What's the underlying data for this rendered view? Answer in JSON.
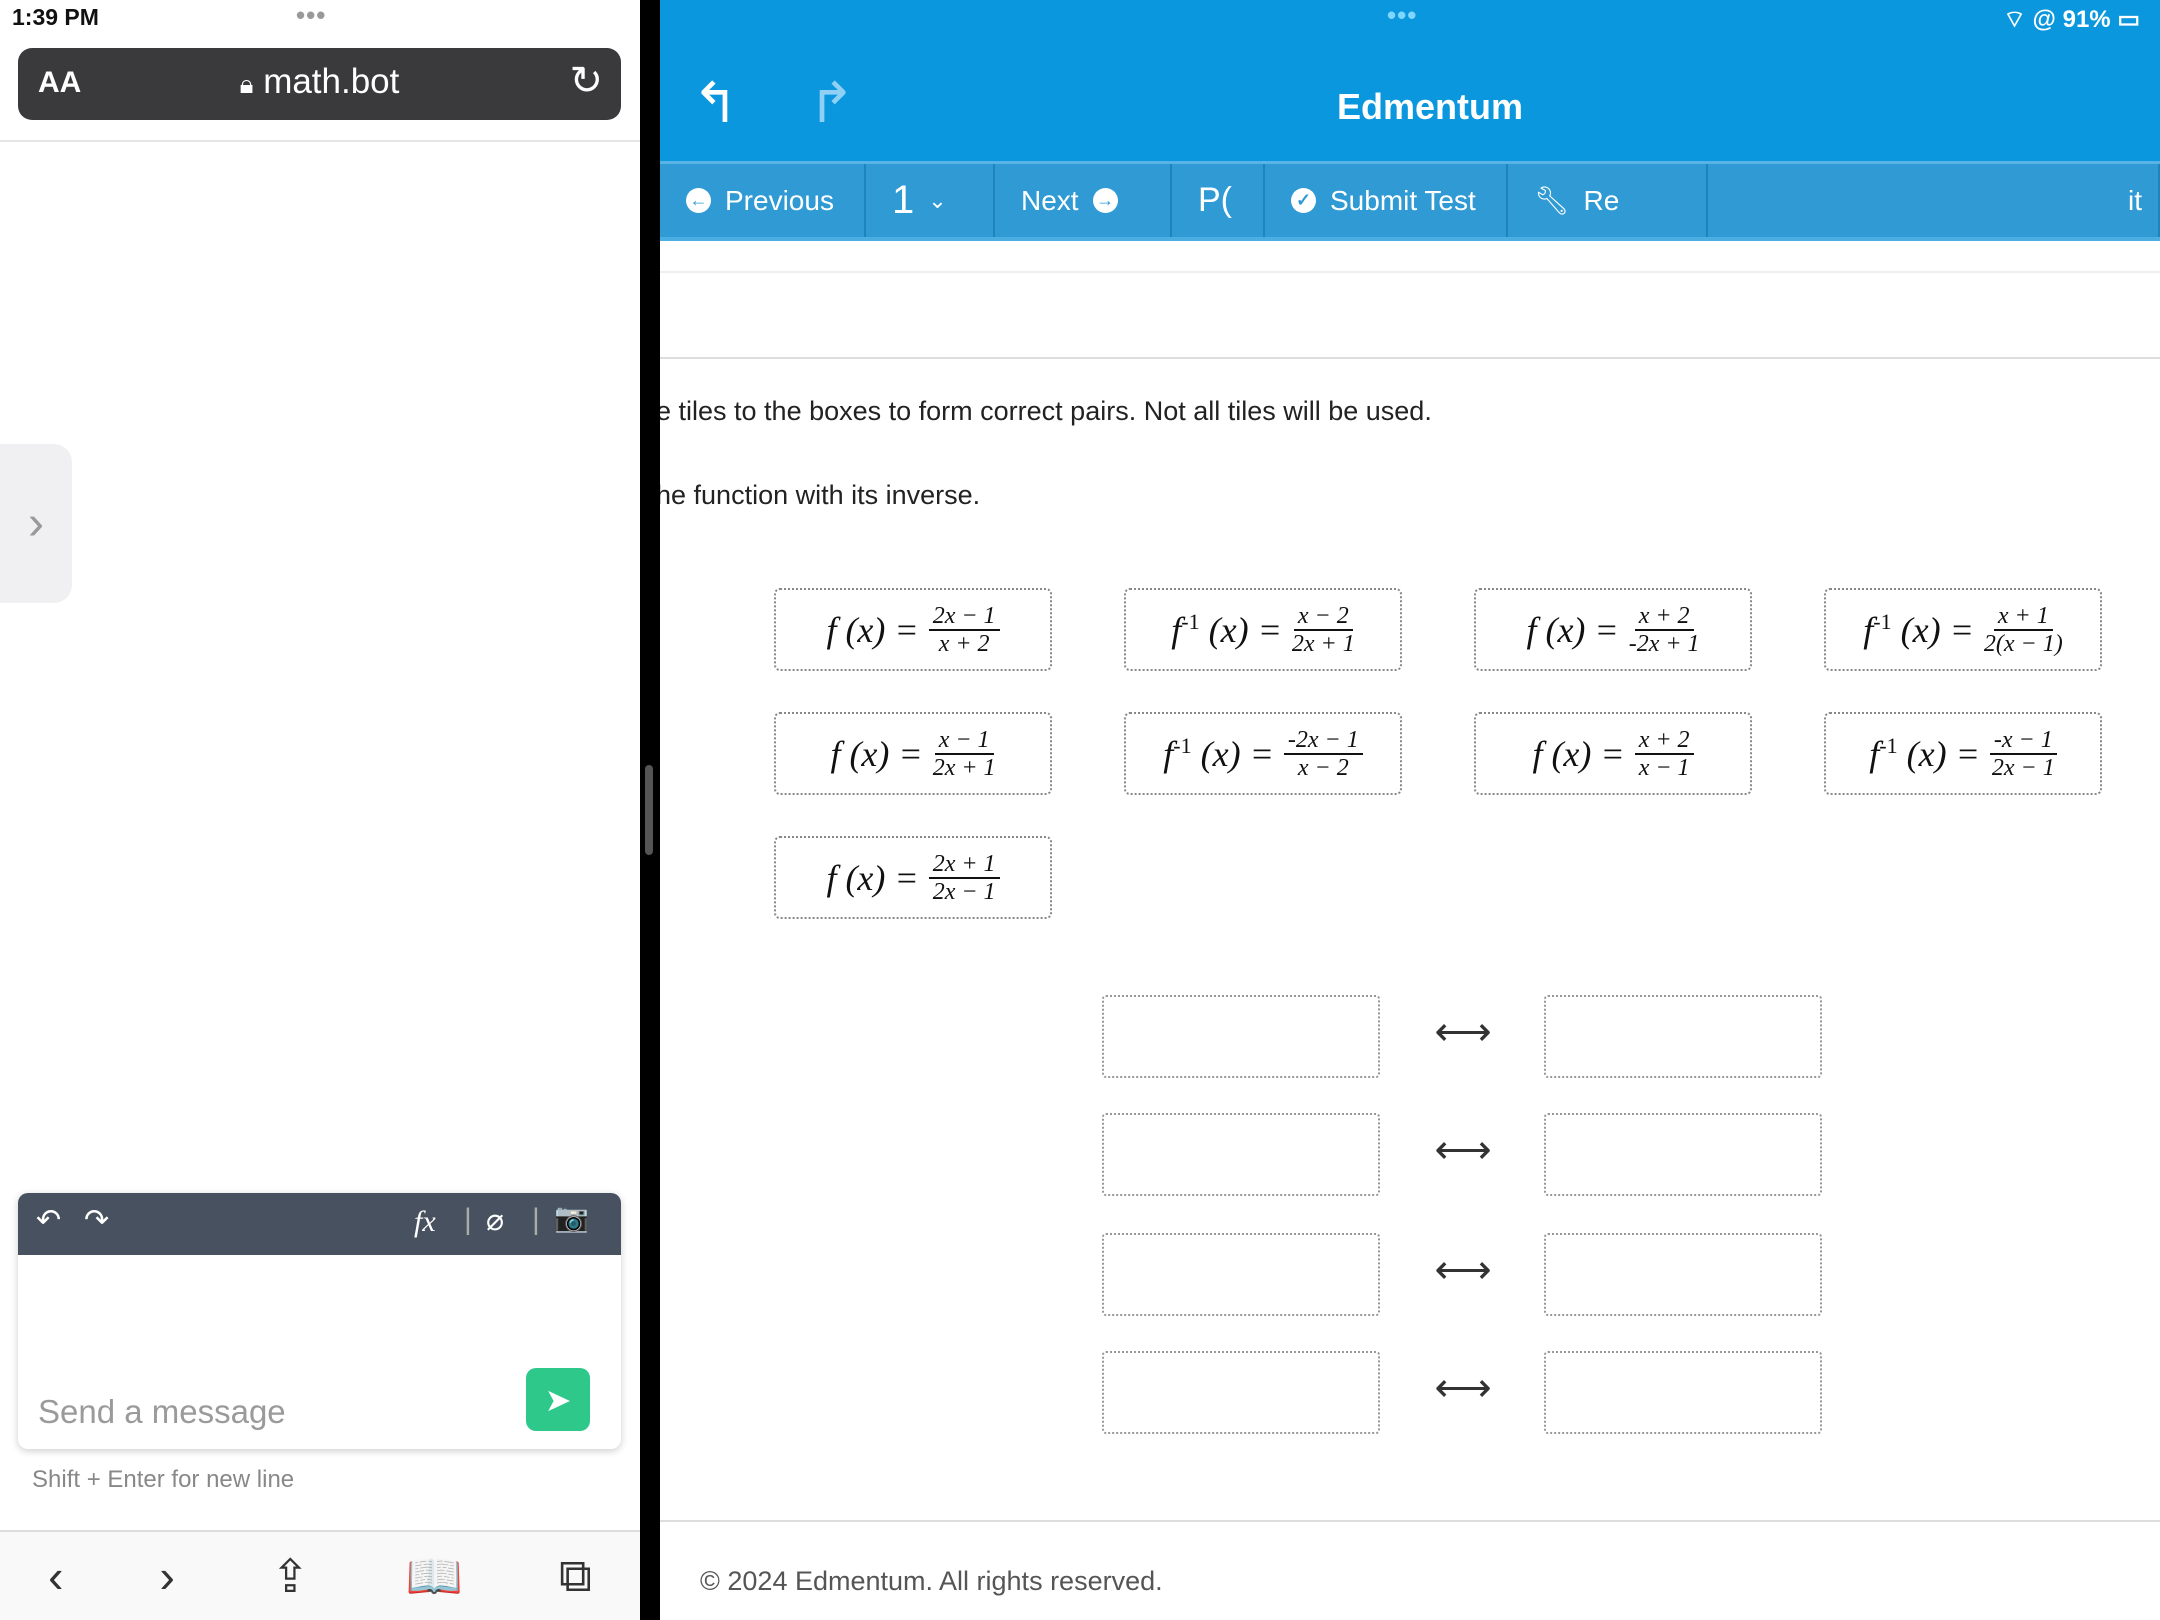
{
  "status_bar": {
    "time": "1:39 PM",
    "battery": "91%",
    "dots": "•••"
  },
  "browser": {
    "text_size": "AA",
    "url": "math.bot",
    "reload_icon": "reload-icon",
    "lock_icon": "lock-icon"
  },
  "chat": {
    "placeholder": "Send a message",
    "hint": "Shift + Enter for new line",
    "tools": {
      "undo": "↶",
      "redo": "↷",
      "fx": "fx",
      "attach": "⌀",
      "camera": "📷"
    }
  },
  "bottom_bar": [
    "‹",
    "›",
    "⇪",
    "📖",
    "⧉"
  ],
  "app": {
    "title": "Edmentum",
    "nav": {
      "previous": "Previous",
      "page": "1",
      "next": "Next",
      "pause": "P(",
      "submit": "Submit Test",
      "review": "Re",
      "exit": "it"
    }
  },
  "instructions": [
    "e tiles to the boxes to form correct pairs. Not all tiles will be used.",
    "he function with its inverse."
  ],
  "tiles": [
    {
      "f": "f",
      "inv": false,
      "num": "2x − 1",
      "den": "x + 2"
    },
    {
      "f": "f",
      "inv": true,
      "num": "x − 2",
      "den": "2x + 1"
    },
    {
      "f": "f",
      "inv": false,
      "num": "x + 2",
      "den": "-2x + 1"
    },
    {
      "f": "f",
      "inv": true,
      "num": "x + 1",
      "den": "2(x − 1)"
    },
    {
      "f": "f",
      "inv": false,
      "num": "x − 1",
      "den": "2x + 1"
    },
    {
      "f": "f",
      "inv": true,
      "num": "-2x − 1",
      "den": "x − 2"
    },
    {
      "f": "f",
      "inv": false,
      "num": "x + 2",
      "den": "x − 1"
    },
    {
      "f": "f",
      "inv": true,
      "num": "-x − 1",
      "den": "2x − 1"
    },
    {
      "f": "f",
      "inv": false,
      "num": "2x + 1",
      "den": "2x − 1"
    }
  ],
  "tile_labels": {
    "fx": "f (x) =",
    "finv": "f",
    "sup": "-1",
    "finv_rest": "(x) ="
  },
  "pairs_arrow": "⟷",
  "footer": "© 2024 Edmentum. All rights reserved.",
  "colors": {
    "header": "#0a97dd",
    "nav": "#2f9ad4",
    "send": "#2ec98a"
  }
}
